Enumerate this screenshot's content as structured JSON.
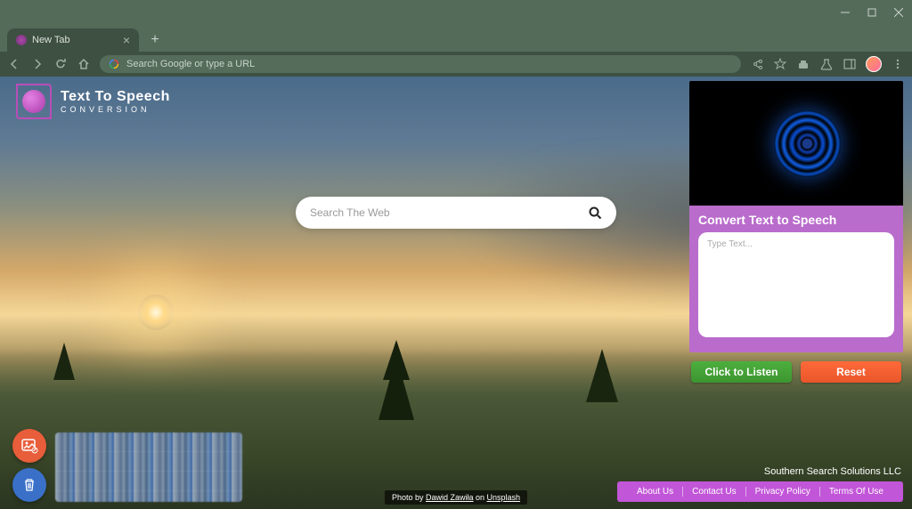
{
  "tab": {
    "title": "New Tab"
  },
  "omnibox": {
    "placeholder": "Search Google or type a URL"
  },
  "logo": {
    "title": "Text To Speech",
    "subtitle": "CONVERSION"
  },
  "search": {
    "placeholder": "Search The Web"
  },
  "tts": {
    "heading": "Convert Text to Speech",
    "textarea_placeholder": "Type Text...",
    "listen_label": "Click to Listen",
    "reset_label": "Reset"
  },
  "company": "Southern Search Solutions LLC",
  "footer": {
    "links": [
      "About Us",
      "Contact Us",
      "Privacy Policy",
      "Terms Of Use"
    ]
  },
  "credit": {
    "prefix": "Photo by ",
    "author": "Dawid Zawiła",
    "middle": " on ",
    "source": "Unsplash"
  },
  "colors": {
    "accent_purple": "#b96ccc",
    "button_green": "#4caf3e",
    "button_orange": "#ff6a3a"
  }
}
